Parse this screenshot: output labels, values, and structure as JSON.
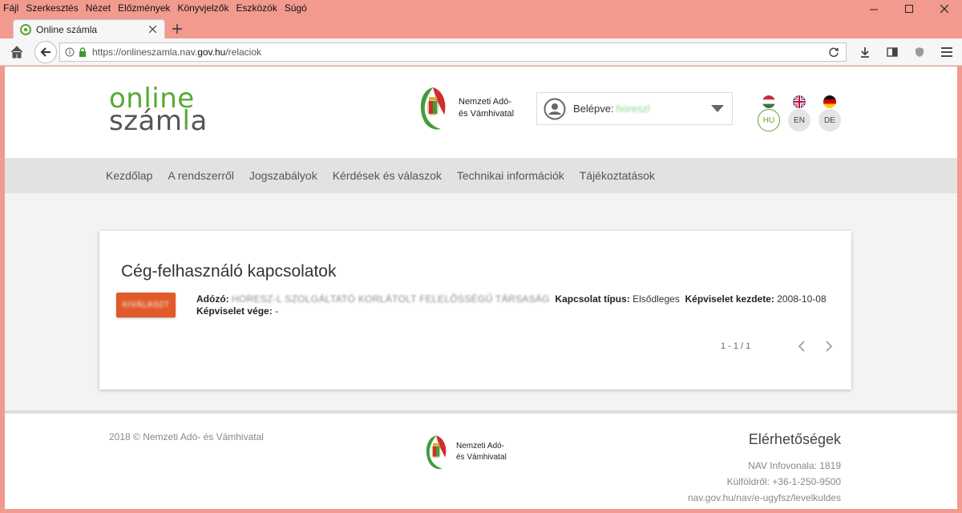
{
  "browser": {
    "menu": [
      "Fájl",
      "Szerkesztés",
      "Nézet",
      "Előzmények",
      "Könyvjelzők",
      "Eszközök",
      "Súgó"
    ],
    "tab_title": "Online számla",
    "url_prefix": "https://onlineszamla.nav.",
    "url_domain": "gov.hu",
    "url_path": "/relaciok"
  },
  "header": {
    "logo_line1": "online",
    "logo_line2_a": "szám",
    "logo_line2_b": "l",
    "logo_line2_c": "a",
    "agency_line1": "Nemzeti Adó-",
    "agency_line2": "és Vámhivatal",
    "login_label": "Belépve:",
    "login_user": "horeszl",
    "languages": [
      {
        "code": "HU",
        "active": true
      },
      {
        "code": "EN",
        "active": false
      },
      {
        "code": "DE",
        "active": false
      }
    ]
  },
  "nav": {
    "items": [
      "Kezdőlap",
      "A rendszerről",
      "Jogszabályok",
      "Kérdések és válaszok",
      "Technikai információk",
      "Tájékoztatások"
    ]
  },
  "card": {
    "title": "Cég-felhasználó kapcsolatok",
    "select_label": "KIVÁLASZT",
    "taxpayer_label": "Adózó:",
    "taxpayer_value": "HORESZ-L SZOLGÁLTATÓ KORLÁTOLT FELELŐSSÉGŰ TÁRSASÁG",
    "type_label": "Kapcsolat típus:",
    "type_value": "Elsődleges",
    "start_label": "Képviselet kezdete:",
    "start_value": "2008-10-08",
    "end_label": "Képviselet vége:",
    "end_value": "-",
    "pager": "1 - 1 / 1"
  },
  "footer": {
    "copyright": "2018 © Nemzeti Adó- és Vámhivatal",
    "agency_line1": "Nemzeti Adó-",
    "agency_line2": "és Vámhivatal",
    "contacts_title": "Elérhetőségek",
    "contacts_lines": [
      "NAV Infovonala: 1819",
      "Külföldről: +36-1-250-9500",
      "nav.gov.hu/nav/e-ugyfsz/levelkuldes"
    ]
  },
  "colors": {
    "brand_green": "#58a935",
    "select_button": "#e05a2a",
    "browser_frame": "#f29a8e"
  }
}
